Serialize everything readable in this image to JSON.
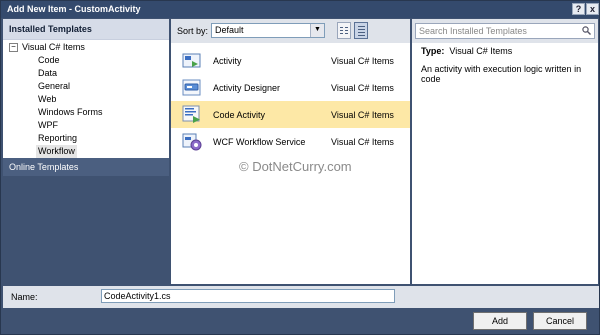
{
  "window": {
    "title": "Add New Item - CustomActivity",
    "help_label": "?",
    "close_label": "x"
  },
  "left_panel": {
    "installed_label": "Installed Templates",
    "tree_root_toggle": "−",
    "tree_root": "Visual C# Items",
    "items": [
      "Code",
      "Data",
      "General",
      "Web",
      "Windows Forms",
      "WPF",
      "Reporting",
      "Workflow"
    ],
    "selected_item": "Workflow",
    "online_label": "Online Templates"
  },
  "toolbar": {
    "sort_label": "Sort by:",
    "sort_value": "Default",
    "dropdown_arrow": "▼"
  },
  "templates": [
    {
      "name": "Activity",
      "lang": "Visual C# Items",
      "icon": "activity-icon",
      "selected": false
    },
    {
      "name": "Activity Designer",
      "lang": "Visual C# Items",
      "icon": "activity-designer-icon",
      "selected": false
    },
    {
      "name": "Code Activity",
      "lang": "Visual C# Items",
      "icon": "code-activity-icon",
      "selected": true
    },
    {
      "name": "WCF Workflow Service",
      "lang": "Visual C# Items",
      "icon": "wcf-workflow-service-icon",
      "selected": false
    }
  ],
  "details": {
    "search_placeholder": "Search Installed Templates",
    "type_label": "Type:",
    "type_value": "Visual C# Items",
    "description": "An activity with execution logic written in code"
  },
  "watermark": "© DotNetCurry.com",
  "name_field": {
    "label": "Name:",
    "value": "CodeActivity1.cs"
  },
  "buttons": {
    "add": "Add",
    "cancel": "Cancel"
  },
  "colors": {
    "title_bar": "#344a6d",
    "selected_row": "#fde8a6",
    "online_templates_bg": "#4b5f80"
  }
}
